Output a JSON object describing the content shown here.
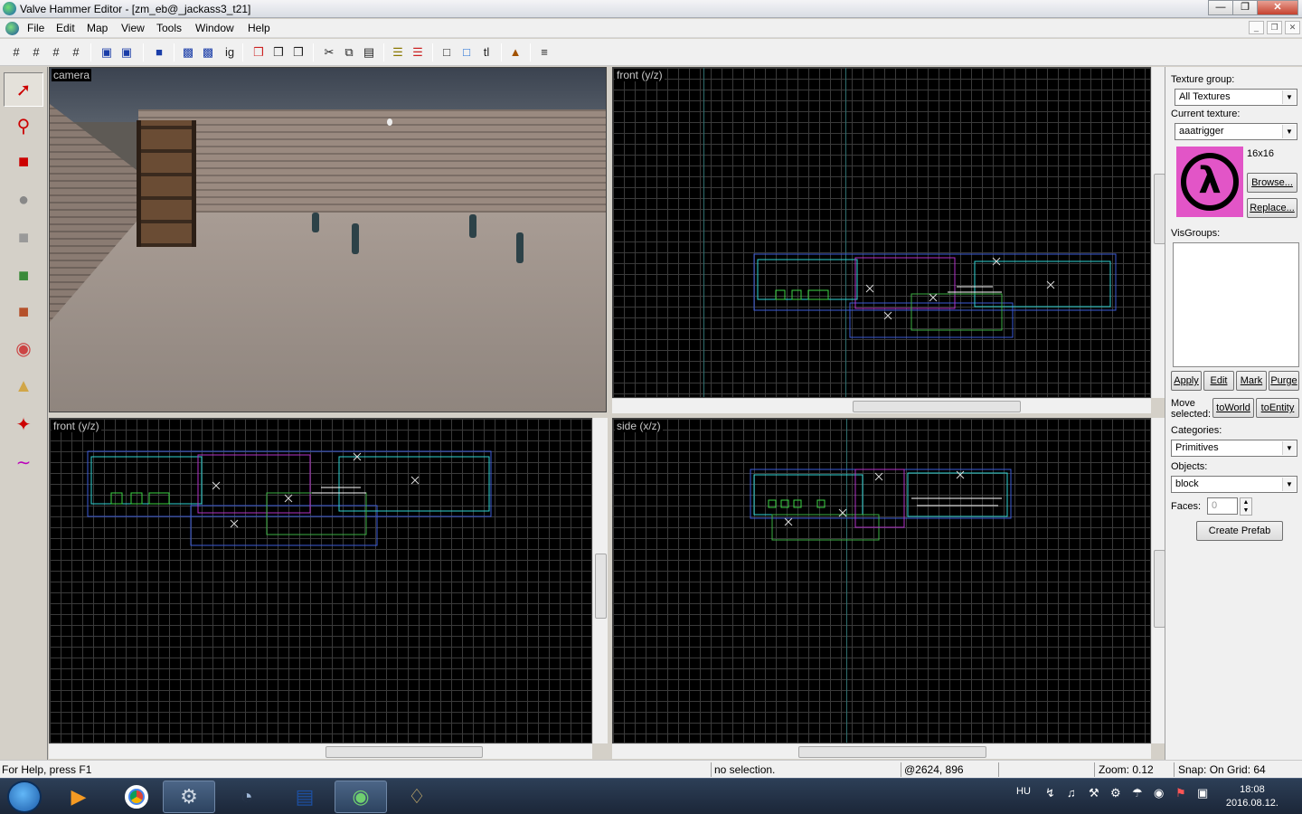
{
  "window": {
    "title": "Valve Hammer Editor - [zm_eb@_jackass3_t21]"
  },
  "menu": {
    "items": [
      "File",
      "Edit",
      "Map",
      "View",
      "Tools",
      "Window",
      "Help"
    ]
  },
  "viewports": {
    "camera": {
      "label": "camera"
    },
    "top_right": {
      "label": "front (y/z)"
    },
    "bottom_left": {
      "label": "front (y/z)"
    },
    "bottom_right": {
      "label": "side (x/z)"
    }
  },
  "panel": {
    "texture_group_label": "Texture group:",
    "texture_group_value": "All Textures",
    "current_texture_label": "Current texture:",
    "current_texture_value": "aaatrigger",
    "texture_size": "16x16",
    "browse": "Browse...",
    "replace": "Replace...",
    "visgroups_label": "VisGroups:",
    "apply": "Apply",
    "edit": "Edit",
    "mark": "Mark",
    "purge": "Purge",
    "move_selected": "Move selected:",
    "to_world": "toWorld",
    "to_entity": "toEntity",
    "categories_label": "Categories:",
    "categories_value": "Primitives",
    "objects_label": "Objects:",
    "objects_value": "block",
    "faces_label": "Faces:",
    "faces_value": "0",
    "create_prefab": "Create Prefab"
  },
  "status": {
    "help": "For Help, press F1",
    "selection": "no selection.",
    "coords": "@2624, 896",
    "zoom": "Zoom: 0.12",
    "snap": "Snap: On Grid: 64"
  },
  "taskbar": {
    "language": "HU",
    "time": "18:08",
    "date": "2016.08.12."
  }
}
